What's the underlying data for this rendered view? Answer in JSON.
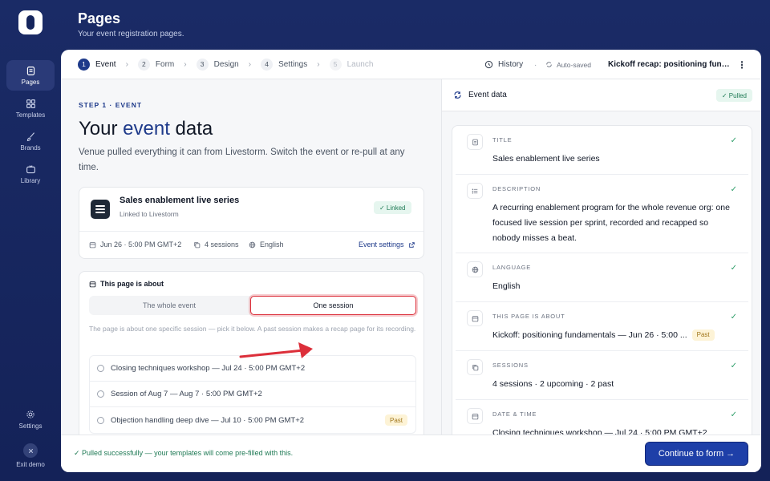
{
  "sidebar": {
    "items": [
      {
        "label": "Pages",
        "icon": "pages-icon"
      },
      {
        "label": "Templates",
        "icon": "grid-icon"
      },
      {
        "label": "Brands",
        "icon": "brush-icon"
      },
      {
        "label": "Library",
        "icon": "tv-icon"
      }
    ],
    "settings_label": "Settings",
    "exit_label": "Exit demo"
  },
  "header": {
    "title": "Pages",
    "subtitle": "Your event registration pages."
  },
  "steps": [
    {
      "num": "1",
      "label": "Event"
    },
    {
      "num": "2",
      "label": "Form"
    },
    {
      "num": "3",
      "label": "Design"
    },
    {
      "num": "4",
      "label": "Settings"
    },
    {
      "num": "5",
      "label": "Launch"
    }
  ],
  "topbar": {
    "history_label": "History",
    "autosaved_label": "Auto-saved",
    "doc_title": "Kickoff recap: positioning fundamentals"
  },
  "left": {
    "step_label": "STEP 1 · EVENT",
    "heading_pre": "Your ",
    "heading_accent": "event",
    "heading_post": " data",
    "lead": "Venue pulled everything it can from Livestorm. Switch the event or re-pull at any time.",
    "event": {
      "title": "Sales enablement live series",
      "subtitle": "Linked to Livestorm",
      "linked_label": "✓ Linked",
      "date": "Jun 26 · 5:00 PM GMT+2",
      "sessions": "4 sessions",
      "language": "English",
      "settings_link": "Event settings"
    },
    "about": {
      "title": "This page is about",
      "option_whole": "The whole event",
      "option_one": "One session",
      "help": "The page is about one specific session — pick it below. A past session makes a recap page for its recording.",
      "sessions": [
        {
          "label": "Closing techniques workshop — Jul 24 · 5:00 PM GMT+2",
          "badge": ""
        },
        {
          "label": "Session of Aug 7 — Aug 7 · 5:00 PM GMT+2",
          "badge": ""
        },
        {
          "label": "Objection handling deep dive — Jul 10 · 5:00 PM GMT+2",
          "badge": "Past"
        }
      ]
    }
  },
  "right": {
    "title": "Event data",
    "pulled_label": "✓ Pulled",
    "fields": [
      {
        "label": "TITLE",
        "value": "Sales enablement live series",
        "icon": "doc-icon"
      },
      {
        "label": "DESCRIPTION",
        "value": "A recurring enablement program for the whole revenue org: one focused live session per sprint, recorded and recapped so nobody misses a beat.",
        "icon": "list-icon"
      },
      {
        "label": "LANGUAGE",
        "value": "English",
        "icon": "globe-icon"
      },
      {
        "label": "THIS PAGE IS ABOUT",
        "value": "Kickoff: positioning fundamentals — Jun 26 · 5:00 ...",
        "badge": "Past",
        "icon": "calendar-icon"
      },
      {
        "label": "SESSIONS",
        "value": "4 sessions · 2 upcoming · 2 past",
        "icon": "copy-icon"
      },
      {
        "label": "DATE & TIME",
        "value": "Closing techniques workshop — Jul 24 · 5:00 PM GMT+2",
        "icon": "calendar-icon"
      }
    ]
  },
  "footer": {
    "message": "✓ Pulled successfully — your templates will come pre-filled with this.",
    "continue_label": "Continue to form →"
  },
  "colors": {
    "brand_navy": "#15255c",
    "accent_blue": "#1e3a8a",
    "success_green": "#1f7a55",
    "past_amber": "#a0761c",
    "annotation_red": "#dc2f3a"
  }
}
